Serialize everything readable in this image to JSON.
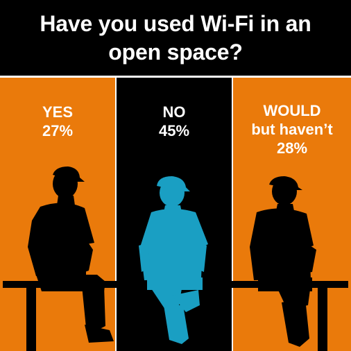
{
  "title_line1": "Have you used Wi-Fi in an",
  "title_line2": "open space?",
  "colors": {
    "orange": "#ea7a0b",
    "black": "#000000",
    "blue": "#1a9fc3",
    "text": "#ffffff"
  },
  "answers": [
    {
      "label": "YES",
      "percent": "27%",
      "value": 27,
      "color": "#ea7a0b",
      "figure": "black-person-seated"
    },
    {
      "label": "NO",
      "percent": "45%",
      "value": 45,
      "color": "#000000",
      "figure": "blue-person-seated"
    },
    {
      "label_line1": "WOULD",
      "label_line2": "but haven’t",
      "percent": "28%",
      "value": 28,
      "color": "#ea7a0b",
      "figure": "black-person-seated"
    }
  ]
}
